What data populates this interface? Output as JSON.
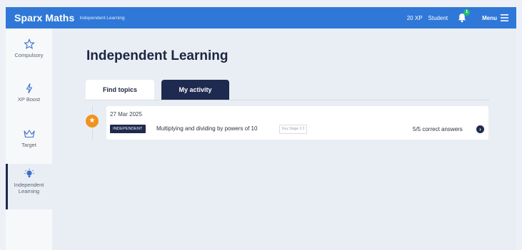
{
  "topbar": {
    "brand": "Sparx Maths",
    "subtitle": "Independent Learning",
    "xp": "20 XP",
    "user": "Student",
    "notification_count": "1",
    "menu_label": "Menu"
  },
  "sidebar": {
    "items": [
      {
        "label": "Compulsory",
        "icon": "star-outline-icon"
      },
      {
        "label": "XP Boost",
        "icon": "lightning-icon"
      },
      {
        "label": "Target",
        "icon": "crown-icon"
      },
      {
        "label_line1": "Independent",
        "label_line2": "Learning",
        "icon": "lightbulb-icon",
        "active": true
      }
    ]
  },
  "main": {
    "title": "Independent Learning",
    "tabs": [
      {
        "label": "Find topics",
        "active": false
      },
      {
        "label": "My activity",
        "active": true
      }
    ],
    "activity": [
      {
        "date": "27 Mar 2025",
        "badge": "INDEPENDENT",
        "topic": "Multiplying and dividing by powers of 10",
        "stage": "Key Stage 3 2",
        "result": "5/5 correct answers"
      }
    ]
  },
  "colors": {
    "topbar": "#2f78d8",
    "navy": "#1e2a4f",
    "badge_orange": "#f0931e",
    "notification_green": "#1fbf6a",
    "background": "#e9eef5"
  }
}
